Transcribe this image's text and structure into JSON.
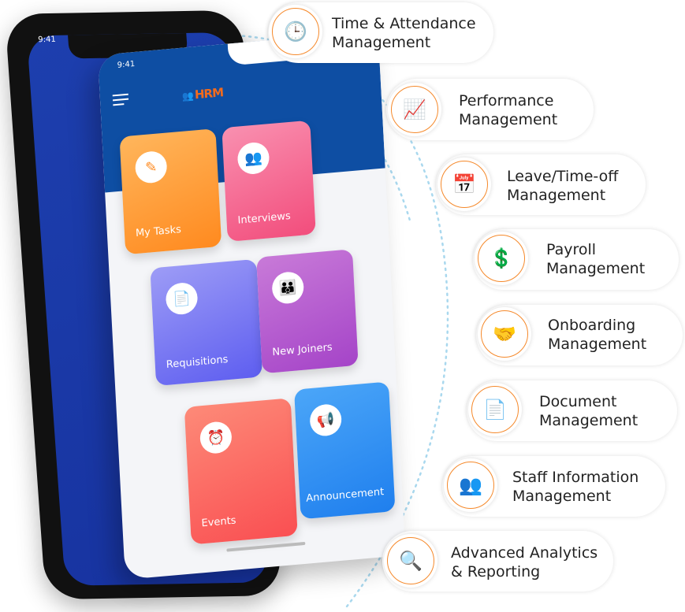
{
  "phone": {
    "back_time": "9:41",
    "front_time": "9:41",
    "logo_text": "HRM",
    "tiles": [
      {
        "label": "My Tasks",
        "icon": "clipboard-edit-icon",
        "color": "#ff9a2e"
      },
      {
        "label": "Interviews",
        "icon": "people-chat-icon",
        "color": "#f5517e"
      },
      {
        "label": "Requisitions",
        "icon": "document-icon",
        "color": "#6b6cf2"
      },
      {
        "label": "New Joiners",
        "icon": "team-icon",
        "color": "#b24fd0"
      },
      {
        "label": "Events",
        "icon": "alarm-clock-icon",
        "color": "#fb5a57"
      },
      {
        "label": "Announcement",
        "icon": "megaphone-icon",
        "color": "#2b8cf5"
      }
    ]
  },
  "features": [
    {
      "line1": "Time & Attendance",
      "line2": "Management",
      "icon": "timesheet-clock-icon"
    },
    {
      "line1": "Performance",
      "line2": "Management",
      "icon": "bar-chart-icon"
    },
    {
      "line1": "Leave/Time-off",
      "line2": "Management",
      "icon": "calendar-person-icon"
    },
    {
      "line1": "Payroll",
      "line2": "Management",
      "icon": "payroll-icon"
    },
    {
      "line1": "Onboarding",
      "line2": "Management",
      "icon": "handshake-icon"
    },
    {
      "line1": "Document",
      "line2": "Management",
      "icon": "document-touch-icon"
    },
    {
      "line1": "Staff Information",
      "line2": "Management",
      "icon": "staff-group-icon"
    },
    {
      "line1": "Advanced Analytics",
      "line2": "& Reporting",
      "icon": "analytics-icon"
    }
  ],
  "colors": {
    "accent_ring": "#f5892b",
    "header_blue": "#0e4ea3",
    "dotted_arc": "#a9d8ee"
  }
}
